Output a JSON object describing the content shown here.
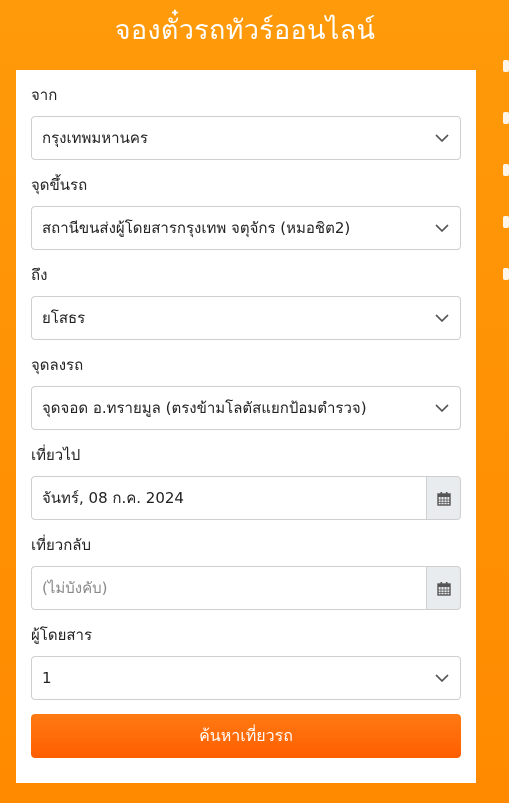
{
  "header": {
    "title": "จองตั๋วรถทัวร์ออนไลน์"
  },
  "form": {
    "origin": {
      "label": "จาก",
      "value": "กรุงเทพมหานคร"
    },
    "pickup": {
      "label": "จุดขึ้นรถ",
      "value": "สถานีขนส่งผู้โดยสารกรุงเทพ จตุจักร (หมอชิต2)"
    },
    "destination": {
      "label": "ถึง",
      "value": "ยโสธร"
    },
    "dropoff": {
      "label": "จุดลงรถ",
      "value": "จุดจอด อ.ทรายมูล (ตรงข้ามโลตัสแยกป้อมตำรวจ)"
    },
    "depart": {
      "label": "เที่ยวไป",
      "value": "จันทร์, 08 ก.ค. 2024"
    },
    "return": {
      "label": "เที่ยวกลับ",
      "placeholder": "(ไม่บังคับ)"
    },
    "passengers": {
      "label": "ผู้โดยสาร",
      "value": "1"
    },
    "search_label": "ค้นหาเที่ยวรถ"
  },
  "colors": {
    "background": "#ff9000",
    "button": "#ff6a00"
  },
  "icons": {
    "select": "chevron-down-icon",
    "date": "calendar-icon"
  }
}
